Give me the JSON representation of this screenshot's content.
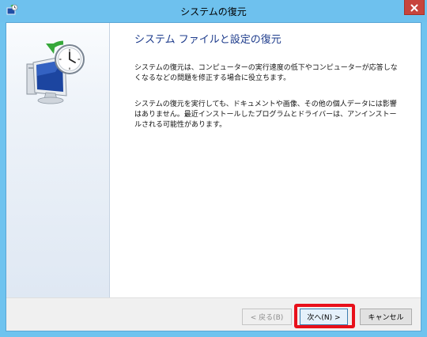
{
  "window": {
    "title": "システムの復元"
  },
  "content": {
    "heading": "システム ファイルと設定の復元",
    "paragraph1": "システムの復元は、コンピューターの実行速度の低下やコンピューターが応答しなくなるなどの問題を修正する場合に役立ちます。",
    "paragraph2": "システムの復元を実行しても、ドキュメントや画像、その他の個人データには影響はありません。最近インストールしたプログラムとドライバーは、アンインストールされる可能性があります。"
  },
  "buttons": {
    "back_label": "< 戻る(B)",
    "next_label": "次へ(N) >",
    "cancel_label": "キャンセル"
  },
  "colors": {
    "titlebar": "#6ec1ee",
    "close_button": "#c7443c",
    "heading": "#1e3c8c",
    "highlight": "#e8101a"
  },
  "icons": {
    "title_icon": "system-restore-icon",
    "hero_icon": "system-restore-clock-icon",
    "close_icon": "close-icon"
  }
}
